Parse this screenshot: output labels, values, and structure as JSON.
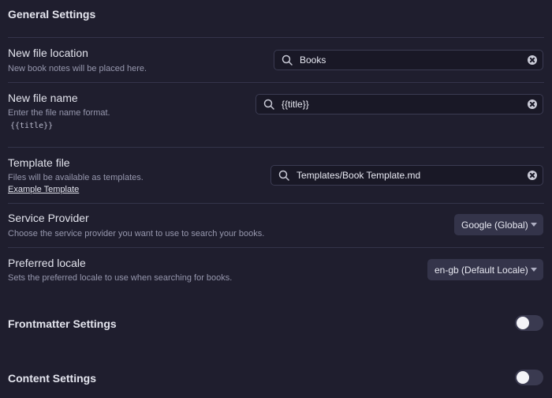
{
  "general": {
    "heading": "General Settings"
  },
  "new_file_location": {
    "name": "New file location",
    "desc": "New book notes will be placed here.",
    "value": "Books"
  },
  "new_file_name": {
    "name": "New file name",
    "desc": "Enter the file name format.",
    "sample": "{{title}}",
    "value": "{{title}}"
  },
  "template_file": {
    "name": "Template file",
    "desc": "Files will be available as templates.",
    "link": "Example Template",
    "value": "Templates/Book Template.md"
  },
  "service_provider": {
    "name": "Service Provider",
    "desc": "Choose the service provider you want to use to search your books.",
    "selected": "Google (Global)"
  },
  "preferred_locale": {
    "name": "Preferred locale",
    "desc": "Sets the preferred locale to use when searching for books.",
    "selected": "en-gb (Default Locale)"
  },
  "frontmatter": {
    "heading": "Frontmatter Settings",
    "enabled": false
  },
  "content": {
    "heading": "Content Settings",
    "enabled": false
  },
  "icons": {
    "search": "search-icon",
    "clear": "clear-icon",
    "caret": "chevron-down-icon"
  },
  "colors": {
    "background": "#1f1e2e",
    "divider": "#34344a",
    "toggle_off": "#3a3a50"
  }
}
